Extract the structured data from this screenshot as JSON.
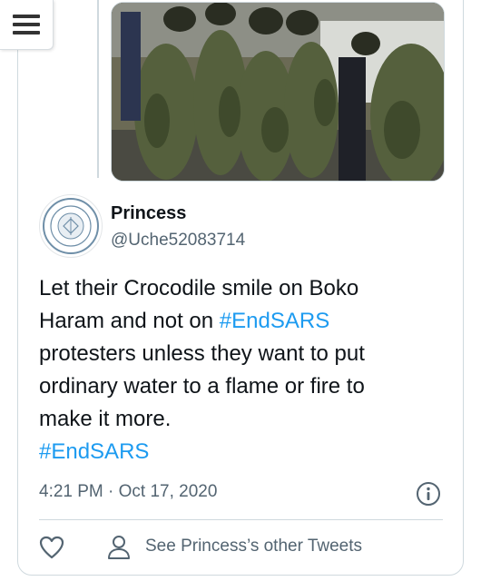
{
  "menu": {
    "icon": "hamburger-menu-icon"
  },
  "media": {
    "description_icon": "photo"
  },
  "tweet": {
    "author_name": "Princess",
    "author_handle": "@Uche52083714",
    "text_lines": [
      [
        {
          "t": "Let their Crocodile smile on Boko",
          "tag": false
        }
      ],
      [
        {
          "t": "Haram and not on ",
          "tag": false
        },
        {
          "t": "#EndSARS",
          "tag": true
        }
      ],
      [
        {
          "t": " protesters unless they want to put",
          "tag": false
        }
      ],
      [
        {
          "t": "ordinary water to a flame or fire to",
          "tag": false
        }
      ],
      [
        {
          "t": "make it more.",
          "tag": false
        }
      ],
      [
        {
          "t": "#EndSARS",
          "tag": true
        }
      ]
    ],
    "timestamp": "4:21 PM · Oct 17, 2020"
  },
  "actions": {
    "see_other": "See Princess’s other Tweets"
  },
  "colors": {
    "link": "#1d9bf0",
    "text": "#0f1419",
    "muted": "#536471",
    "border": "#cfd9de"
  }
}
